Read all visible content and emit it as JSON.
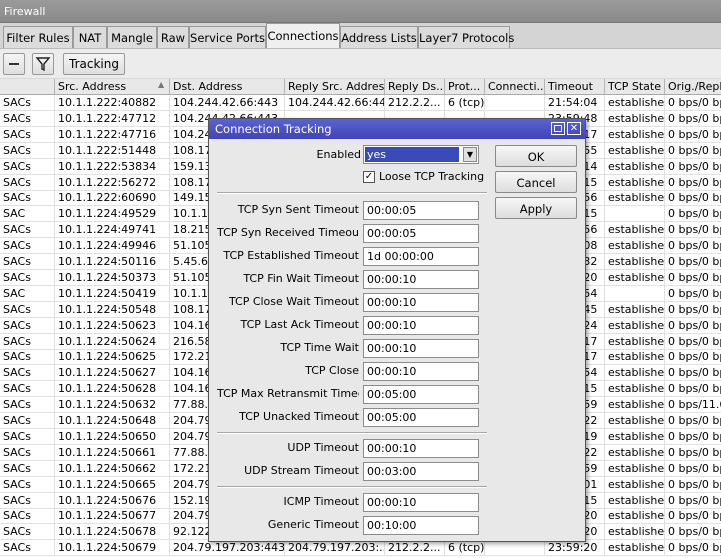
{
  "window_title": "Firewall",
  "tabs": [
    "Filter Rules",
    "NAT",
    "Mangle",
    "Raw",
    "Service Ports",
    "Connections",
    "Address Lists",
    "Layer7 Protocols"
  ],
  "active_tab": 5,
  "toolbar": {
    "tracking_label": "Tracking"
  },
  "columns": [
    "",
    "Src. Address",
    "Dst. Address",
    "Reply Src. Address",
    "Reply Ds...",
    "Prot...",
    "Connecti...",
    "Timeout",
    "TCP State",
    "Orig./Repl..."
  ],
  "rows": [
    [
      "SACs",
      "10.1.1.222:40882",
      "104.244.42.66:443",
      "104.244.42.66:443",
      "212.2.2...",
      "6 (tcp)",
      "",
      "21:54:04",
      "establishe",
      "0 bps/0 bps"
    ],
    [
      "SACs",
      "10.1.1.222:47712",
      "104.244.42.66:443",
      "",
      "",
      "",
      "",
      "23:59:48",
      "establishe",
      "0 bps/0 bps"
    ],
    [
      "SACs",
      "10.1.1.222:47716",
      "104.244.42.66:443",
      "",
      "",
      "",
      "",
      "23:59:17",
      "establishe",
      "0 bps/0 bps"
    ],
    [
      "SACs",
      "10.1.1.222:51448",
      "108.177.",
      "",
      "",
      "",
      "",
      "23:59:55",
      "establishe",
      "0 bps/0 bps"
    ],
    [
      "SACs",
      "10.1.1.222:53834",
      "159.138.",
      "",
      "",
      "",
      "",
      "23:59:14",
      "establishe",
      "0 bps/0 bps"
    ],
    [
      "SACs",
      "10.1.1.222:56272",
      "108.177.",
      "",
      "",
      "",
      "",
      "23:59:15",
      "establishe",
      "0 bps/0 bps"
    ],
    [
      "SACs",
      "10.1.1.222:60690",
      "149.154.",
      "",
      "",
      "",
      "",
      "23:59:56",
      "establishe",
      "0 bps/0 bps"
    ],
    [
      "SAC",
      "10.1.1.224:49529",
      "10.1.1.",
      "",
      "",
      "",
      "",
      "23:59:15",
      "",
      "0 bps/0 bps"
    ],
    [
      "SACs",
      "10.1.1.224:49741",
      "18.215.",
      "",
      "",
      "",
      "",
      "23:59:56",
      "establishe",
      "0 bps/0 bps"
    ],
    [
      "SACs",
      "10.1.1.224:49946",
      "51.105.",
      "",
      "",
      "",
      "",
      "23:59:08",
      "establishe",
      "0 bps/0 bps"
    ],
    [
      "SACs",
      "10.1.1.224:50116",
      "5.45.62.",
      "",
      "",
      "",
      "",
      "23:59:32",
      "establishe",
      "0 bps/0 bps"
    ],
    [
      "SACs",
      "10.1.1.224:50373",
      "51.105.",
      "",
      "",
      "",
      "",
      "23:59:20",
      "establishe",
      "0 bps/0 bps"
    ],
    [
      "SAC",
      "10.1.1.224:50419",
      "10.1.1.",
      "",
      "",
      "",
      "",
      "23:59:54",
      "",
      "0 bps/0 bps"
    ],
    [
      "SACs",
      "10.1.1.224:50548",
      "108.177.",
      "",
      "",
      "",
      "",
      "23:59:45",
      "establishe",
      "0 bps/0 bps"
    ],
    [
      "SACs",
      "10.1.1.224:50623",
      "104.16.",
      "",
      "",
      "",
      "",
      "23:59:24",
      "establishe",
      "0 bps/0 bps"
    ],
    [
      "SACs",
      "10.1.1.224:50624",
      "216.58.",
      "",
      "",
      "",
      "",
      "23:59:17",
      "establishe",
      "0 bps/0 bps"
    ],
    [
      "SACs",
      "10.1.1.224:50625",
      "172.217.",
      "",
      "",
      "",
      "",
      "23:59:17",
      "establishe",
      "0 bps/0 bps"
    ],
    [
      "SACs",
      "10.1.1.224:50627",
      "104.16.",
      "",
      "",
      "",
      "",
      "23:59:54",
      "establishe",
      "0 bps/0 bps"
    ],
    [
      "SACs",
      "10.1.1.224:50628",
      "104.16.",
      "",
      "",
      "",
      "",
      "23:59:15",
      "establishe",
      "0 bps/0 bps"
    ],
    [
      "SACs",
      "10.1.1.224:50632",
      "77.88.2",
      "",
      "",
      "",
      "",
      "23:59:59",
      "establishe",
      "0 bps/11.6"
    ],
    [
      "SACs",
      "10.1.1.224:50648",
      "204.79.",
      "",
      "",
      "",
      "",
      "23:59:22",
      "establishe",
      "0 bps/0 bps"
    ],
    [
      "SACs",
      "10.1.1.224:50650",
      "204.79.",
      "",
      "",
      "",
      "",
      "23:59:19",
      "establishe",
      "0 bps/0 bps"
    ],
    [
      "SACs",
      "10.1.1.224:50661",
      "77.88.2",
      "",
      "",
      "",
      "",
      "23:59:22",
      "establishe",
      "0 bps/0 bps"
    ],
    [
      "SACs",
      "10.1.1.224:50662",
      "172.217.",
      "",
      "",
      "",
      "",
      "23:59:59",
      "establishe",
      "0 bps/0 bps"
    ],
    [
      "SACs",
      "10.1.1.224:50665",
      "204.79.",
      "",
      "",
      "",
      "",
      "23:59:01",
      "establishe",
      "0 bps/0 bps"
    ],
    [
      "SACs",
      "10.1.1.224:50676",
      "152.199.",
      "",
      "",
      "",
      "",
      "23:59:15",
      "establishe",
      "0 bps/0 bps"
    ],
    [
      "SACs",
      "10.1.1.224:50677",
      "204.79.",
      "",
      "",
      "",
      "",
      "23:59:20",
      "establishe",
      "0 bps/0 bps"
    ],
    [
      "SACs",
      "10.1.1.224:50678",
      "92.122.",
      "",
      "",
      "",
      "",
      "23:59:20",
      "establishe",
      "0 bps/0 bps"
    ],
    [
      "SACs",
      "10.1.1.224:50679",
      "204.79.197.203:443",
      "204.79.197.203:...",
      "212.2.2...",
      "6 (tcp)",
      "",
      "23:59:20",
      "establishe",
      "0 bps/0 bps"
    ]
  ],
  "dialog": {
    "title": "Connection Tracking",
    "enabled_label": "Enabled",
    "enabled_value": "yes",
    "loose_label": "Loose TCP Tracking",
    "loose_checked": true,
    "fields": [
      {
        "label": "TCP Syn Sent Timeout",
        "value": "00:00:05"
      },
      {
        "label": "TCP Syn Received Timeout",
        "value": "00:00:05"
      },
      {
        "label": "TCP Established Timeout",
        "value": "1d 00:00:00"
      },
      {
        "label": "TCP Fin Wait Timeout",
        "value": "00:00:10"
      },
      {
        "label": "TCP Close Wait Timeout",
        "value": "00:00:10"
      },
      {
        "label": "TCP Last Ack Timeout",
        "value": "00:00:10"
      },
      {
        "label": "TCP Time Wait",
        "value": "00:00:10"
      },
      {
        "label": "TCP Close",
        "value": "00:00:10"
      },
      {
        "label": "TCP Max Retransmit Timeout",
        "value": "00:05:00"
      },
      {
        "label": "TCP Unacked Timeout",
        "value": "00:05:00"
      },
      {
        "label": "UDP Timeout",
        "value": "00:00:10"
      },
      {
        "label": "UDP Stream Timeout",
        "value": "00:03:00"
      },
      {
        "label": "ICMP Timeout",
        "value": "00:00:10"
      },
      {
        "label": "Generic Timeout",
        "value": "00:10:00"
      }
    ],
    "ok_label": "OK",
    "cancel_label": "Cancel",
    "apply_label": "Apply"
  }
}
